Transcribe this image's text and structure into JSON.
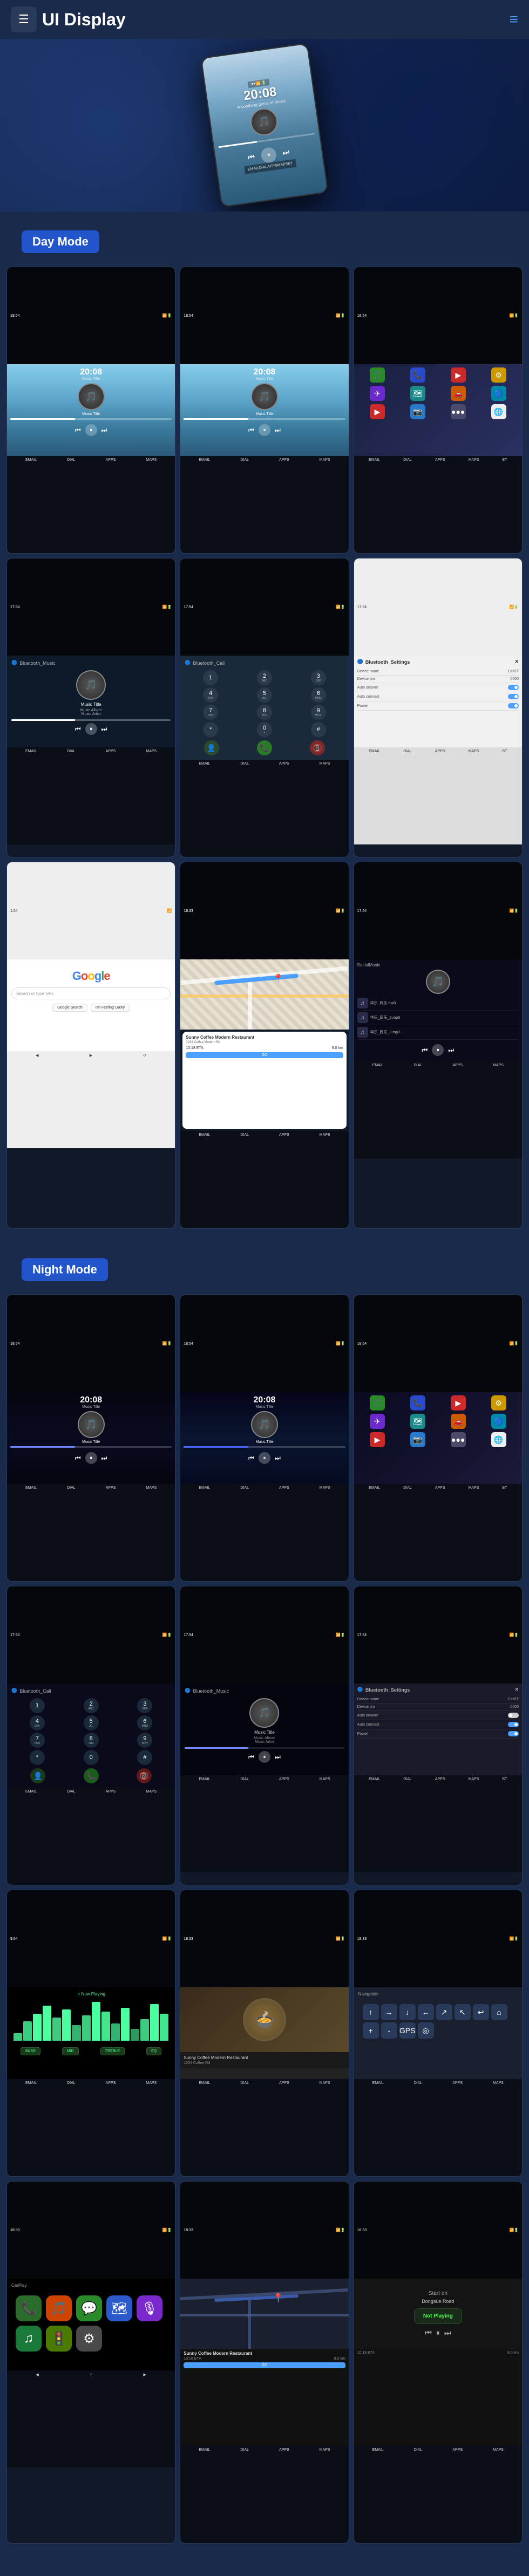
{
  "header": {
    "title": "UI Display",
    "menu_label": "≡",
    "nav_icon": "☰"
  },
  "sections": {
    "day_mode": "Day Mode",
    "night_mode": "Night Mode"
  },
  "device": {
    "time": "20:08",
    "subtitle": "A soothing piece of music"
  },
  "day_screens": [
    {
      "id": "day-music-1",
      "type": "music",
      "time": "20:08",
      "subtitle": "Music Title",
      "theme": "day"
    },
    {
      "id": "day-music-2",
      "type": "music",
      "time": "20:08",
      "subtitle": "Music Title",
      "theme": "day"
    },
    {
      "id": "day-apps",
      "type": "apps",
      "theme": "day"
    },
    {
      "id": "day-bluetooth-music",
      "type": "bluetooth_music",
      "title": "Bluetooth_Music",
      "track": "Music Title",
      "album": "Music Album",
      "artist": "Music Artist"
    },
    {
      "id": "day-phone",
      "type": "phone",
      "title": "Bluetooth_Call"
    },
    {
      "id": "day-settings",
      "type": "settings",
      "title": "Bluetooth_Settings",
      "device_name": "CarBT",
      "device_pin": "0000",
      "auto_answer": "Auto answer",
      "auto_connect": "Auto connect",
      "power": "Power"
    },
    {
      "id": "day-google",
      "type": "google",
      "search_placeholder": "Search or type URL"
    },
    {
      "id": "day-map",
      "type": "map",
      "destination": "Sunny Coffee Modern Restaurant",
      "address": "1234 Coffee Rd",
      "go_label": "GO",
      "eta": "10:18 ETA",
      "distance": "9.0 km"
    },
    {
      "id": "day-social",
      "type": "social_music",
      "title": "SocialMusic",
      "tracks": [
        "华乐_同乐.mp3",
        "华乐_同乐_2.mp3",
        "华乐_同乐_3.mp3"
      ]
    }
  ],
  "night_screens": [
    {
      "id": "night-music-1",
      "type": "music_night",
      "time": "20:08",
      "subtitle": "Music Title",
      "theme": "night_space"
    },
    {
      "id": "night-music-2",
      "type": "music_night",
      "time": "20:08",
      "subtitle": "Music Title",
      "theme": "night_blue"
    },
    {
      "id": "night-apps",
      "type": "apps_night",
      "theme": "night"
    },
    {
      "id": "night-phone",
      "type": "phone_night",
      "title": "Bluetooth_Call"
    },
    {
      "id": "night-bluetooth-music",
      "type": "bluetooth_music_night",
      "title": "Bluetooth_Music",
      "track": "Music Title",
      "album": "Music Album",
      "artist": "Music Artist"
    },
    {
      "id": "night-settings",
      "type": "settings_night",
      "title": "Bluetooth_Settings",
      "device_name": "CarBT",
      "device_pin": "0000"
    },
    {
      "id": "night-waveform",
      "type": "waveform",
      "theme": "night"
    },
    {
      "id": "night-food",
      "type": "food",
      "theme": "night"
    },
    {
      "id": "night-nav",
      "type": "navigation_night",
      "theme": "night"
    },
    {
      "id": "night-carplay",
      "type": "carplay",
      "theme": "night"
    },
    {
      "id": "night-map2",
      "type": "map_night",
      "destination": "Sunny Coffee Modern Restaurant",
      "go_label": "GO",
      "eta": "10:18 ETA",
      "distance": "9.0 km"
    },
    {
      "id": "night-not-playing",
      "type": "not_playing",
      "label": "Not Playing",
      "destination": "Start on Dongsue Road"
    }
  ],
  "bottom_bar": {
    "items": [
      "EMAIL",
      "DIAL",
      "APPS",
      "MAPS",
      "BT"
    ]
  },
  "colors": {
    "primary_blue": "#2255cc",
    "accent": "#4a9fff",
    "dark_bg": "#1a2a4a",
    "card_bg": "#111827",
    "night_bg": "#050510"
  }
}
